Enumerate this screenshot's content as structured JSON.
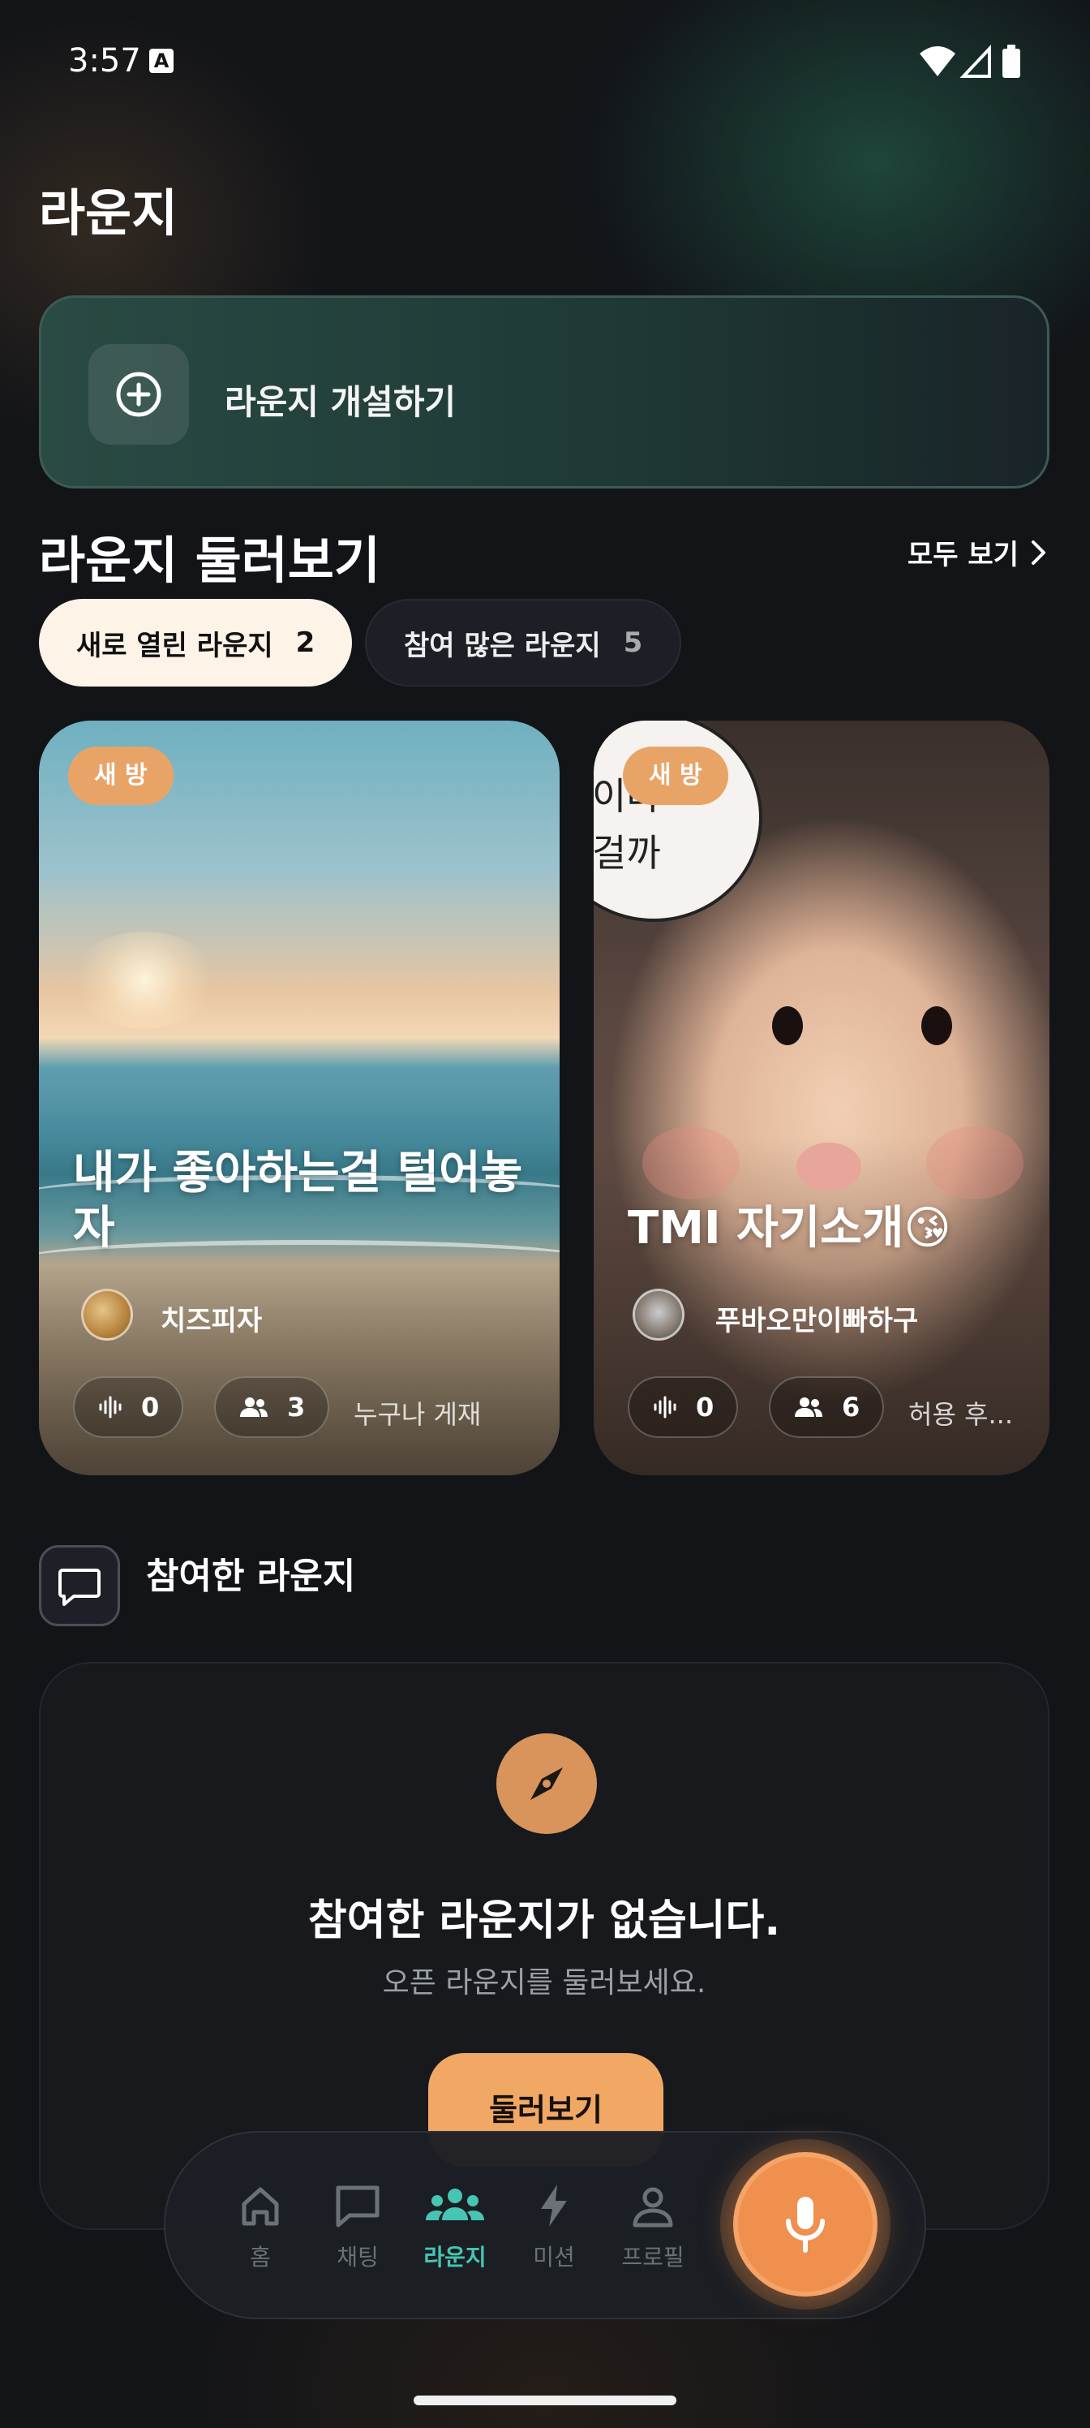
{
  "status_bar": {
    "time": "3:57",
    "notification_badge": "A"
  },
  "page": {
    "title": "라운지"
  },
  "create_card": {
    "label": "라운지 개설하기",
    "icon": "plus-circle-icon"
  },
  "browse": {
    "title": "라운지 둘러보기",
    "see_all": "모두 보기",
    "chips": [
      {
        "label": "새로 열린 라운지",
        "count": "2",
        "selected": true
      },
      {
        "label": "참여 많은 라운지",
        "count": "5",
        "selected": false
      }
    ],
    "cards": [
      {
        "badge": "새 방",
        "title": "내가 좋아하는걸 털어놓자",
        "host": "치즈피자",
        "voice_count": "0",
        "participants": "3",
        "access": "누구나 게재"
      },
      {
        "badge": "새 방",
        "title": "TMI 자기소개😘",
        "host": "푸바오만이빠하구",
        "voice_count": "0",
        "participants": "6",
        "access": "허용 후...",
        "image_text": "이라\n걸까"
      }
    ]
  },
  "joined": {
    "title": "참여한 라운지",
    "empty_title": "참여한 라운지가 없습니다.",
    "empty_subtitle": "오픈 라운지를 둘러보세요.",
    "button_label": "둘러보기"
  },
  "nav": {
    "items": [
      {
        "label": "홈",
        "icon": "home-icon",
        "active": false
      },
      {
        "label": "채팅",
        "icon": "chat-icon",
        "active": false
      },
      {
        "label": "라운지",
        "icon": "people-icon",
        "active": true
      },
      {
        "label": "미션",
        "icon": "bolt-icon",
        "active": false
      },
      {
        "label": "프로필",
        "icon": "person-icon",
        "active": false
      }
    ],
    "mic_icon": "mic-icon"
  },
  "colors": {
    "accent_teal": "#46c5b4",
    "accent_orange": "#f0a864",
    "background": "#121418"
  }
}
